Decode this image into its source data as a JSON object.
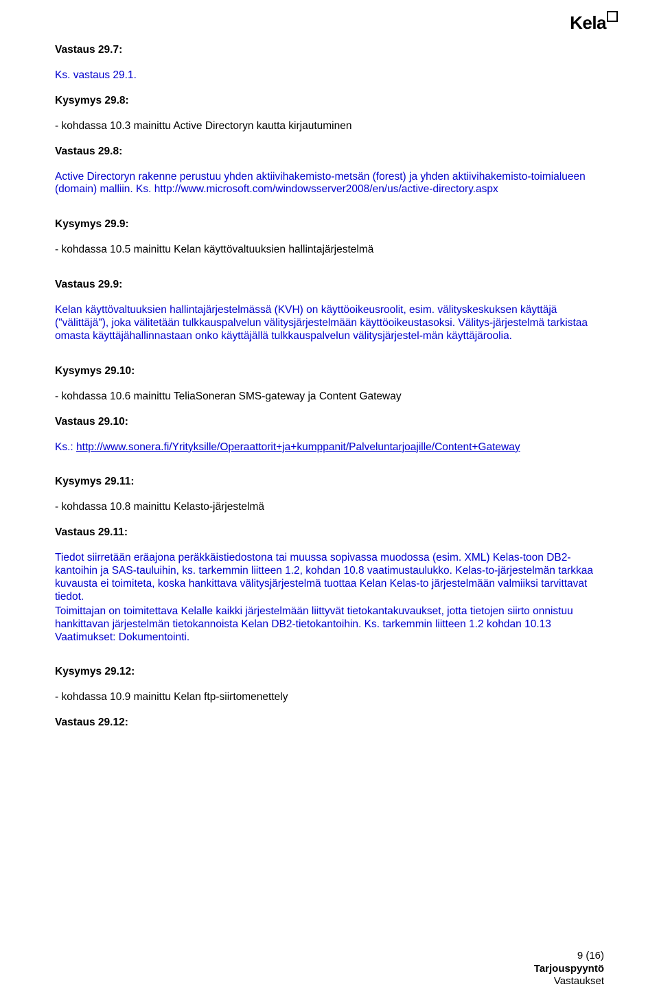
{
  "logo": {
    "text": "Kela"
  },
  "sections": [
    {
      "label": "Vastaus 29.7:",
      "type": "heading"
    },
    {
      "text": "Ks. vastaus 29.1.",
      "blue": true,
      "type": "para"
    },
    {
      "label": "Kysymys 29.8:",
      "type": "heading"
    },
    {
      "text": "- kohdassa 10.3 mainittu Active Directoryn kautta kirjautuminen",
      "type": "para"
    },
    {
      "label": "Vastaus 29.8:",
      "type": "heading"
    },
    {
      "text": "Active Directoryn rakenne perustuu yhden aktiivihakemisto-metsän (forest) ja yhden aktiivihakemisto-toimialueen (domain) malliin. Ks. http://www.microsoft.com/windowsserver2008/en/us/active-directory.aspx",
      "blue": true,
      "type": "para"
    },
    {
      "label": "Kysymys 29.9:",
      "type": "heading"
    },
    {
      "text": "- kohdassa 10.5 mainittu Kelan käyttövaltuuksien hallintajärjestelmä",
      "type": "para"
    },
    {
      "label": "Vastaus 29.9:",
      "type": "heading"
    },
    {
      "text": "Kelan käyttövaltuuksien hallintajärjestelmässä (KVH) on käyttöoikeusroolit, esim. välityskeskuksen käyttäjä (\"välittäjä\"), joka välitetään tulkkauspalvelun välitysjärjestelmään käyttöoikeustasoksi. Välitys-järjestelmä tarkistaa omasta käyttäjähallinnastaan onko käyttäjällä tulkkauspalvelun välitysjärjestel-män käyttäjäroolia.",
      "blue": true,
      "type": "para"
    },
    {
      "label": "Kysymys 29.10:",
      "type": "heading"
    },
    {
      "text": "- kohdassa 10.6 mainittu TeliaSoneran SMS-gateway ja Content Gateway",
      "type": "para"
    },
    {
      "label": "Vastaus 29.10:",
      "type": "heading"
    },
    {
      "prefix": "Ks.: ",
      "link": "http://www.sonera.fi/Yrityksille/Operaattorit+ja+kumppanit/Palveluntarjoajille/Content+Gateway",
      "type": "linkpara"
    },
    {
      "label": "Kysymys 29.11:",
      "type": "heading"
    },
    {
      "text": "- kohdassa 10.8 mainittu Kelasto-järjestelmä",
      "type": "para"
    },
    {
      "label": "Vastaus 29.11:",
      "type": "heading"
    },
    {
      "text": "Tiedot siirretään eräajona peräkkäistiedostona tai muussa sopivassa muodossa (esim. XML) Kelas-toon DB2-kantoihin ja SAS-tauluihin, ks. tarkemmin liitteen 1.2, kohdan 10.8 vaatimustaulukko. Kelas-to-järjestelmän tarkkaa kuvausta ei toimiteta, koska hankittava välitysjärjestelmä tuottaa Kelan Kelas-to järjestelmään valmiiksi tarvittavat tiedot.",
      "blue": true,
      "type": "para-tight"
    },
    {
      "text": "Toimittajan on toimitettava Kelalle kaikki järjestelmään liittyvät tietokantakuvaukset, jotta tietojen siirto onnistuu hankittavan järjestelmän tietokannoista Kelan DB2-tietokantoihin. Ks. tarkemmin liitteen 1.2 kohdan 10.13 Vaatimukset: Dokumentointi.",
      "blue": true,
      "type": "para"
    },
    {
      "label": "Kysymys 29.12:",
      "type": "heading"
    },
    {
      "text": "- kohdassa 10.9 mainittu Kelan ftp-siirtomenettely",
      "type": "para"
    },
    {
      "label": "Vastaus 29.12:",
      "type": "heading"
    }
  ],
  "footer": {
    "page": "9 (16)",
    "line1": "Tarjouspyyntö",
    "line2": "Vastaukset"
  }
}
